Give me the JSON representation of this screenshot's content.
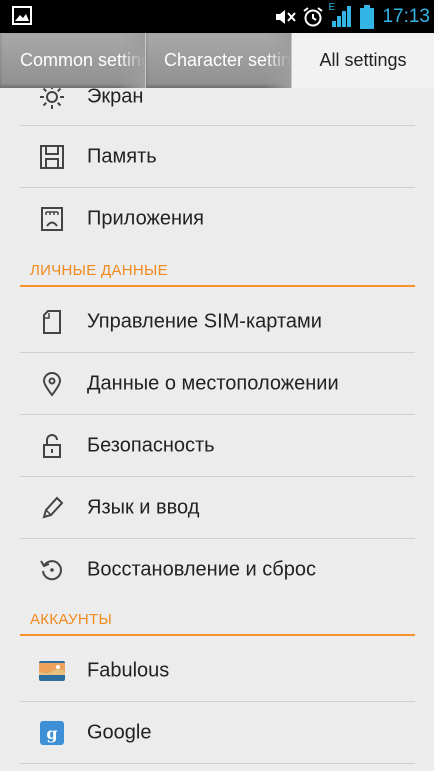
{
  "status_bar": {
    "time": "17:13",
    "icons": [
      "gallery-notification-icon",
      "mute-icon",
      "alarm-icon",
      "signal-icon",
      "battery-icon"
    ],
    "signal_label": "E",
    "accent": "#33b5e5"
  },
  "tabs": [
    {
      "label": "Common settings",
      "active": false
    },
    {
      "label": "Character settings",
      "active": false
    },
    {
      "label": "All settings",
      "active": true
    }
  ],
  "settings": {
    "device_items": [
      {
        "icon": "brightness-icon",
        "label": "Экран"
      },
      {
        "icon": "storage-icon",
        "label": "Память"
      },
      {
        "icon": "apps-icon",
        "label": "Приложения"
      }
    ],
    "personal_header": "ЛИЧНЫЕ ДАННЫЕ",
    "personal_items": [
      {
        "icon": "sim-card-icon",
        "label": "Управление SIM-картами"
      },
      {
        "icon": "location-icon",
        "label": "Данные о местоположении"
      },
      {
        "icon": "lock-icon",
        "label": "Безопасность"
      },
      {
        "icon": "pencil-icon",
        "label": "Язык и ввод"
      },
      {
        "icon": "restore-icon",
        "label": "Восстановление и сброс"
      }
    ],
    "accounts_header": "АККАУНТЫ",
    "account_items": [
      {
        "icon": "fabulous-icon",
        "label": "Fabulous"
      },
      {
        "icon": "google-icon",
        "label": "Google"
      }
    ]
  },
  "colors": {
    "section_accent": "#f08a1d",
    "status_accent": "#33b5e5",
    "background": "#ececec"
  }
}
